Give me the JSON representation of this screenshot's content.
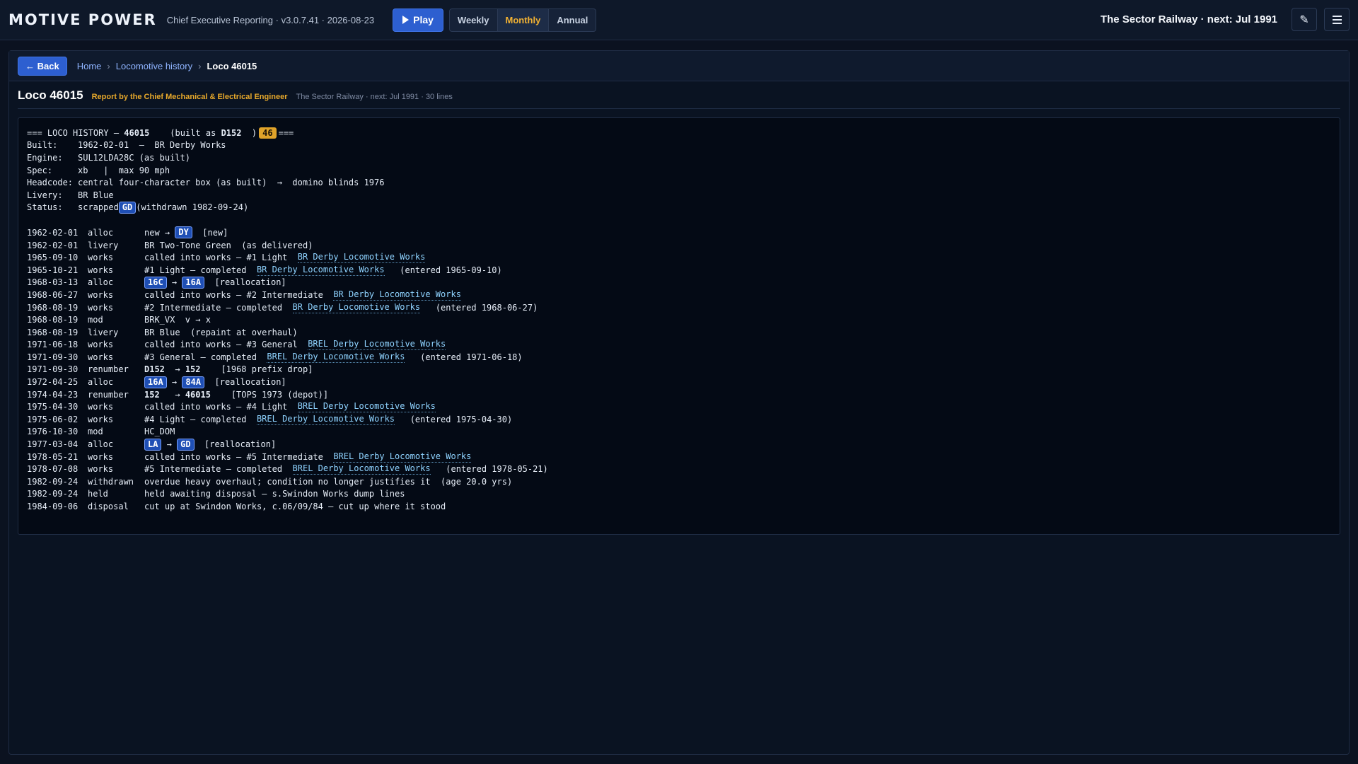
{
  "topbar": {
    "brand": "MOTIVE POWER",
    "subtitle": "Chief Executive Reporting · v3.0.7.41 · 2026-08-23",
    "play_label": "Play",
    "periods": [
      "Weekly",
      "Monthly",
      "Annual"
    ],
    "active_period": "Monthly",
    "railway_status": "The Sector Railway · next: Jul 1991",
    "edit_icon": "✎"
  },
  "breadcrumb": {
    "back_label": "← Back",
    "home": "Home",
    "section": "Locomotive history",
    "current": "Loco 46015"
  },
  "title": {
    "heading": "Loco 46015",
    "report_by": "Report by the Chief Mechanical & Electrical Engineer",
    "meta": "The Sector Railway · next: Jul 1991 · 30 lines"
  },
  "history": {
    "header": {
      "prefix": "=== LOCO HISTORY — ",
      "number": "46015",
      "built_as_label": "    (built as ",
      "built_as": "D152",
      "built_as_close": "  )",
      "class_badge": "46",
      "suffix": "==="
    },
    "summary": [
      {
        "key": "Built:",
        "value": "1962-02-01  —  BR Derby Works"
      },
      {
        "key": "Engine:",
        "value": "SUL12LDA28C (as built)"
      },
      {
        "key": "Spec:",
        "value": "xb   |  max 90 mph"
      },
      {
        "key": "Headcode:",
        "value": "central four-character box (as built)  →  domino blinds 1976"
      },
      {
        "key": "Livery:",
        "value": "BR Blue"
      }
    ],
    "status": {
      "key": "Status:",
      "value": "scrapped",
      "depot": "GD",
      "note": "(withdrawn 1982-09-24)"
    },
    "events": [
      {
        "date": "1962-02-01",
        "type": "alloc",
        "parts": [
          {
            "t": "new → "
          },
          {
            "d": "DY"
          },
          {
            "t": "  [new]"
          }
        ]
      },
      {
        "date": "1962-02-01",
        "type": "livery",
        "parts": [
          {
            "t": "BR Two-Tone Green  (as delivered)"
          }
        ]
      },
      {
        "date": "1965-09-10",
        "type": "works",
        "parts": [
          {
            "t": "called into works — #1 Light  "
          },
          {
            "w": "BR Derby Locomotive Works"
          }
        ]
      },
      {
        "date": "1965-10-21",
        "type": "works",
        "parts": [
          {
            "t": "#1 Light — completed  "
          },
          {
            "w": "BR Derby Locomotive Works"
          },
          {
            "t": "   (entered 1965-09-10)"
          }
        ]
      },
      {
        "date": "1968-03-13",
        "type": "alloc",
        "parts": [
          {
            "d": "16C"
          },
          {
            "t": " → "
          },
          {
            "d": "16A"
          },
          {
            "t": "  [reallocation]"
          }
        ]
      },
      {
        "date": "1968-06-27",
        "type": "works",
        "parts": [
          {
            "t": "called into works — #2 Intermediate  "
          },
          {
            "w": "BR Derby Locomotive Works"
          }
        ]
      },
      {
        "date": "1968-08-19",
        "type": "works",
        "parts": [
          {
            "t": "#2 Intermediate — completed  "
          },
          {
            "w": "BR Derby Locomotive Works"
          },
          {
            "t": "   (entered 1968-06-27)"
          }
        ]
      },
      {
        "date": "1968-08-19",
        "type": "mod",
        "parts": [
          {
            "t": "BRK_VX  v → x"
          }
        ]
      },
      {
        "date": "1968-08-19",
        "type": "livery",
        "parts": [
          {
            "t": "BR Blue  (repaint at overhaul)"
          }
        ]
      },
      {
        "date": "1971-06-18",
        "type": "works",
        "parts": [
          {
            "t": "called into works — #3 General  "
          },
          {
            "w": "BREL Derby Locomotive Works"
          }
        ]
      },
      {
        "date": "1971-09-30",
        "type": "works",
        "parts": [
          {
            "t": "#3 General — completed  "
          },
          {
            "w": "BREL Derby Locomotive Works"
          },
          {
            "t": "   (entered 1971-06-18)"
          }
        ]
      },
      {
        "date": "1971-09-30",
        "type": "renumber",
        "parts": [
          {
            "b": "D152"
          },
          {
            "t": "  → "
          },
          {
            "b": "152"
          },
          {
            "t": "    [1968 prefix drop]"
          }
        ]
      },
      {
        "date": "1972-04-25",
        "type": "alloc",
        "parts": [
          {
            "d": "16A"
          },
          {
            "t": " → "
          },
          {
            "d": "84A"
          },
          {
            "t": "  [reallocation]"
          }
        ]
      },
      {
        "date": "1974-04-23",
        "type": "renumber",
        "parts": [
          {
            "b": "152"
          },
          {
            "t": "   → "
          },
          {
            "b": "46015"
          },
          {
            "t": "    [TOPS 1973 (depot)]"
          }
        ]
      },
      {
        "date": "1975-04-30",
        "type": "works",
        "parts": [
          {
            "t": "called into works — #4 Light  "
          },
          {
            "w": "BREL Derby Locomotive Works"
          }
        ]
      },
      {
        "date": "1975-06-02",
        "type": "works",
        "parts": [
          {
            "t": "#4 Light — completed  "
          },
          {
            "w": "BREL Derby Locomotive Works"
          },
          {
            "t": "   (entered 1975-04-30)"
          }
        ]
      },
      {
        "date": "1976-10-30",
        "type": "mod",
        "parts": [
          {
            "t": "HC_DOM"
          }
        ]
      },
      {
        "date": "1977-03-04",
        "type": "alloc",
        "parts": [
          {
            "d": "LA"
          },
          {
            "t": " → "
          },
          {
            "d": "GD"
          },
          {
            "t": "  [reallocation]"
          }
        ]
      },
      {
        "date": "1978-05-21",
        "type": "works",
        "parts": [
          {
            "t": "called into works — #5 Intermediate  "
          },
          {
            "w": "BREL Derby Locomotive Works"
          }
        ]
      },
      {
        "date": "1978-07-08",
        "type": "works",
        "parts": [
          {
            "t": "#5 Intermediate — completed  "
          },
          {
            "w": "BREL Derby Locomotive Works"
          },
          {
            "t": "   (entered 1978-05-21)"
          }
        ]
      },
      {
        "date": "1982-09-24",
        "type": "withdrawn",
        "parts": [
          {
            "t": "overdue heavy overhaul; condition no longer justifies it  (age 20.0 yrs)"
          }
        ]
      },
      {
        "date": "1982-09-24",
        "type": "held",
        "parts": [
          {
            "t": "held awaiting disposal — s.Swindon Works dump lines"
          }
        ]
      },
      {
        "date": "1984-09-06",
        "type": "disposal",
        "parts": [
          {
            "t": "cut up at Swindon Works, c.06/09/84 — cut up where it stood"
          }
        ]
      }
    ]
  }
}
